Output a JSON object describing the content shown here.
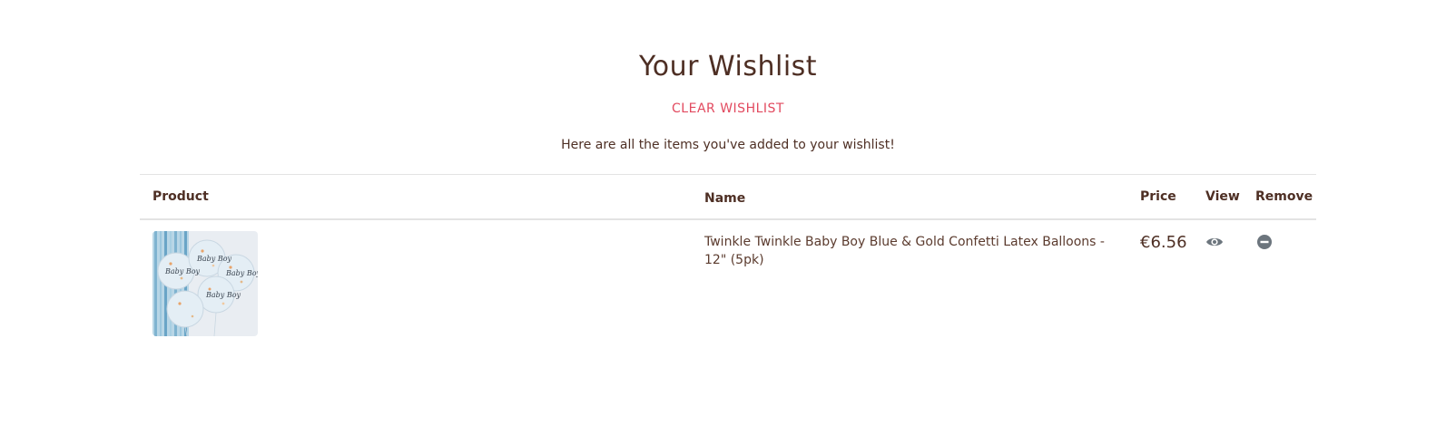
{
  "page": {
    "title": "Your Wishlist",
    "clear_link": "CLEAR WISHLIST",
    "subtitle": "Here are all the items you've added to your wishlist!"
  },
  "table": {
    "headers": {
      "product": "Product",
      "name": "Name",
      "price": "Price",
      "view": "View",
      "remove": "Remove"
    },
    "rows": [
      {
        "name": "Twinkle Twinkle Baby Boy Blue & Gold Confetti Latex Balloons - 12\" (5pk)",
        "price": "€6.56",
        "image_alt": "Baby Boy confetti balloons",
        "image_labels": [
          "Baby Boy",
          "Baby Boy",
          "Baby Boy",
          "Baby Boy"
        ],
        "view_icon": "eye-icon",
        "remove_icon": "minus-circle-icon"
      }
    ]
  },
  "colors": {
    "text": "#4e2f24",
    "accent": "#e24a5f",
    "icon": "#6c757d",
    "divider": "#e3e3e3"
  }
}
